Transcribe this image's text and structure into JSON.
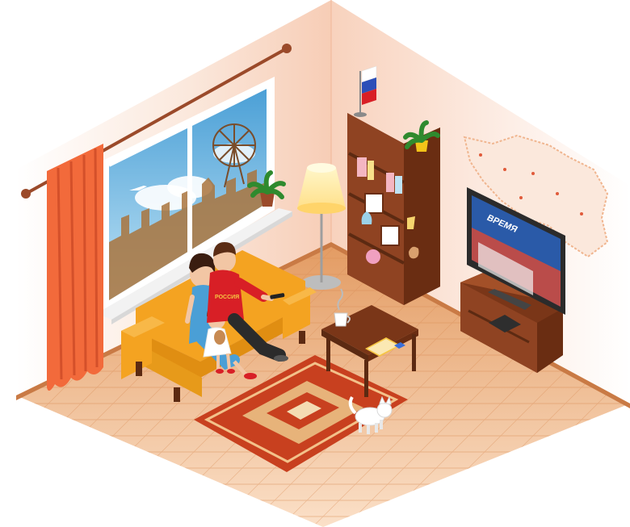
{
  "tv": {
    "channel_text": "ВРЕМЯ"
  },
  "father": {
    "shirt_text": "РОССИЯ"
  },
  "flag": {
    "colors": [
      "#ffffff",
      "#2c4fb8",
      "#d81f26"
    ]
  },
  "palette": {
    "wall_left": "#fbe3d4",
    "wall_right": "#fdeee6",
    "floor": "#e8a56f",
    "sofa": "#f4a321",
    "curtain": "#f26a3b",
    "wood": "#8a3f1e",
    "rug": "#c8401f"
  }
}
